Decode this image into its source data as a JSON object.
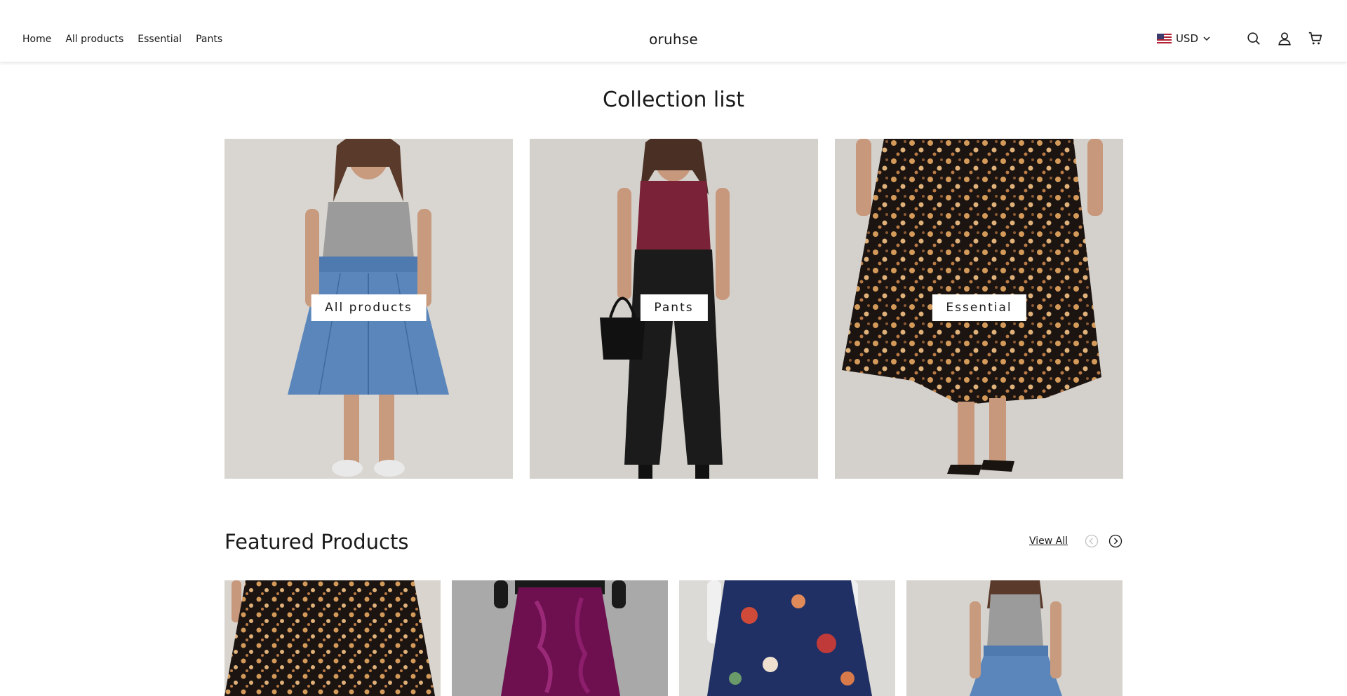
{
  "header": {
    "nav": [
      "Home",
      "All products",
      "Essential",
      "Pants"
    ],
    "logo": "oruhse",
    "currency": "USD"
  },
  "collections": {
    "title": "Collection list",
    "items": [
      {
        "label": "All products"
      },
      {
        "label": "Pants"
      },
      {
        "label": "Essential"
      }
    ]
  },
  "featured": {
    "title": "Featured Products",
    "view_all": "View All"
  },
  "icons": {
    "search": "search-icon",
    "account": "user-icon",
    "cart": "cart-icon",
    "prev": "chevron-left-circle-icon",
    "next": "chevron-right-circle-icon",
    "currency_dropdown": "chevron-down-icon",
    "flag": "us-flag-icon"
  }
}
